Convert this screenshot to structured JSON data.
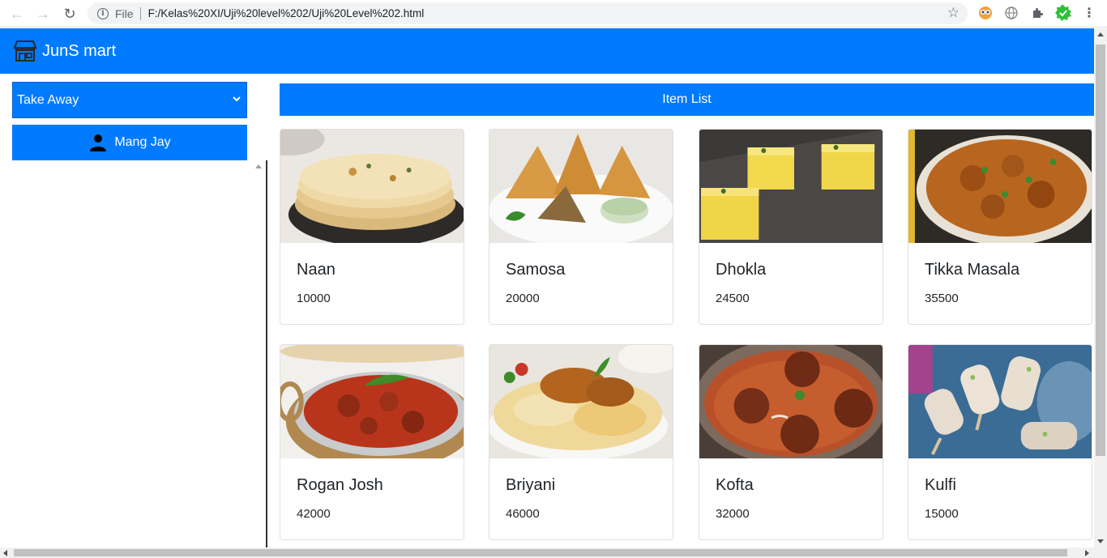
{
  "browser": {
    "scheme": "File",
    "url": "F:/Kelas%20XI/Uji%20level%202/Uji%20Level%202.html"
  },
  "app": {
    "brand": "JunS mart",
    "accent_color": "#007bff"
  },
  "sidebar": {
    "order_type": "Take Away",
    "user_name": "Mang Jay"
  },
  "main": {
    "header": "Item List",
    "items": [
      {
        "name": "Naan",
        "price": "10000"
      },
      {
        "name": "Samosa",
        "price": "20000"
      },
      {
        "name": "Dhokla",
        "price": "24500"
      },
      {
        "name": "Tikka Masala",
        "price": "35500"
      },
      {
        "name": "Rogan Josh",
        "price": "42000"
      },
      {
        "name": "Briyani",
        "price": "46000"
      },
      {
        "name": "Kofta",
        "price": "32000"
      },
      {
        "name": "Kulfi",
        "price": "15000"
      }
    ]
  },
  "icons": {
    "back": "arrow-left-icon",
    "forward": "arrow-right-icon",
    "reload": "reload-icon",
    "info": "info-icon",
    "bookmark": "star-icon",
    "extensions": "puzzle-icon",
    "menu": "kebab-menu-icon",
    "store": "store-icon",
    "user": "user-icon",
    "dropdown": "chevron-down-icon"
  }
}
